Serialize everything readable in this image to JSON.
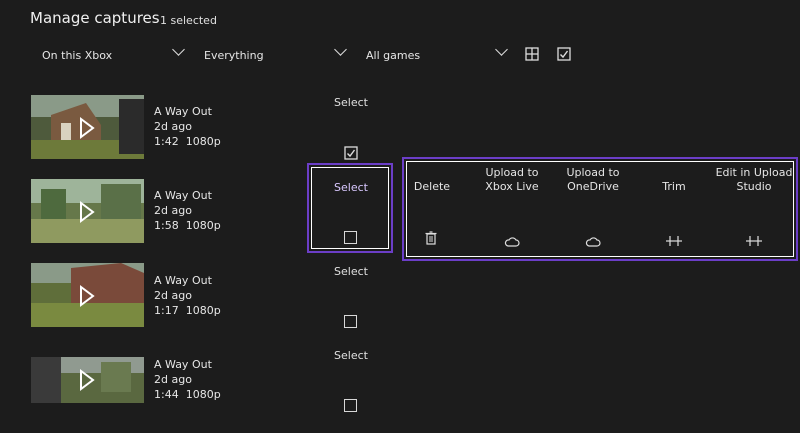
{
  "header": {
    "title": "Manage captures",
    "selection_status": "1 selected"
  },
  "filters": {
    "location": "On this Xbox",
    "type": "Everything",
    "games": "All games"
  },
  "toolbar": {
    "grid_icon": "grid-view-icon",
    "check_icon": "select-all-checkbox-icon"
  },
  "captures": [
    {
      "game": "A Way Out",
      "age": "2d ago",
      "duration": "1:42",
      "resolution": "1080p",
      "select_label": "Select",
      "checked": true
    },
    {
      "game": "A Way Out",
      "age": "2d ago",
      "duration": "1:58",
      "resolution": "1080p",
      "select_label": "Select",
      "checked": false
    },
    {
      "game": "A Way Out",
      "age": "2d ago",
      "duration": "1:17",
      "resolution": "1080p",
      "select_label": "Select",
      "checked": false
    },
    {
      "game": "A Way Out",
      "age": "2d ago",
      "duration": "1:44",
      "resolution": "1080p",
      "select_label": "Select",
      "checked": false
    }
  ],
  "actions": [
    {
      "label_line1": "Delete",
      "label_line2": "",
      "icon": "trash-icon"
    },
    {
      "label_line1": "Upload to",
      "label_line2": "Xbox Live",
      "icon": "cloud-icon"
    },
    {
      "label_line1": "Upload to",
      "label_line2": "OneDrive",
      "icon": "cloud-icon"
    },
    {
      "label_line1": "Trim",
      "label_line2": "",
      "icon": "trim-icon"
    },
    {
      "label_line1": "Edit in Upload",
      "label_line2": "Studio",
      "icon": "trim-icon"
    }
  ],
  "colors": {
    "background": "#1c1c1c",
    "focus": "#6b3ec7",
    "text": "#e6e6e6"
  }
}
